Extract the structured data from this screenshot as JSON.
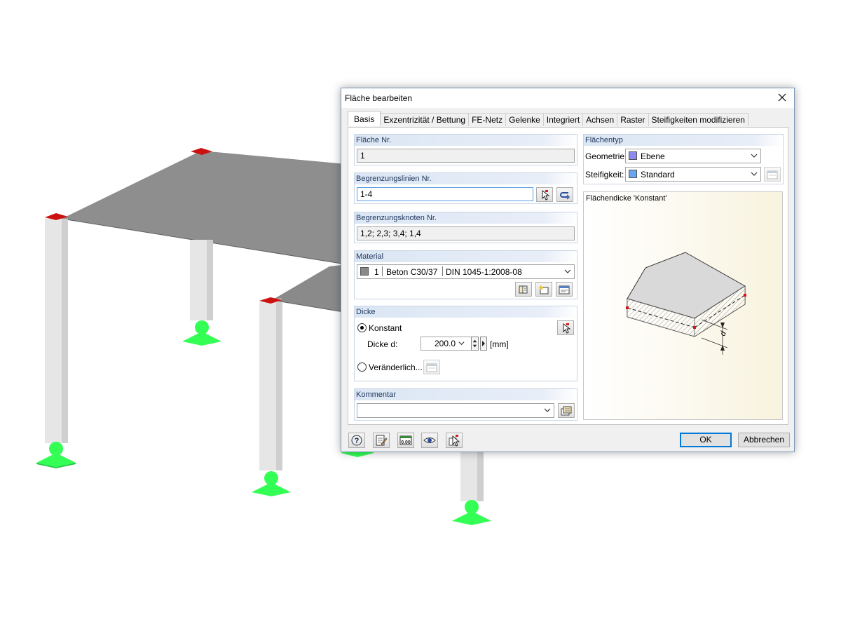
{
  "dialog": {
    "title": "Fläche bearbeiten",
    "tabs": [
      "Basis",
      "Exzentrizität / Bettung",
      "FE-Netz",
      "Gelenke",
      "Integriert",
      "Achsen",
      "Raster",
      "Steifigkeiten modifizieren"
    ],
    "active_tab": "Basis"
  },
  "surface_no": {
    "header": "Fläche Nr.",
    "value": "1"
  },
  "boundary_lines": {
    "header": "Begrenzungslinien Nr.",
    "value": "1-4"
  },
  "boundary_nodes": {
    "header": "Begrenzungsknoten Nr.",
    "value": "1,2; 2,3; 3,4; 1,4"
  },
  "material": {
    "header": "Material",
    "number": "1",
    "name": "Beton C30/37",
    "norm": "DIN 1045-1:2008-08",
    "color": "#8a8a8a"
  },
  "thickness": {
    "header": "Dicke",
    "constant_label": "Konstant",
    "thickness_label": "Dicke d:",
    "value": "200.0",
    "unit": "[mm]",
    "variable_label": "Veränderlich...",
    "selected": "Konstant"
  },
  "comment": {
    "header": "Kommentar",
    "value": ""
  },
  "surface_type": {
    "header": "Flächentyp",
    "geometry_label": "Geometrie:",
    "geometry_value": "Ebene",
    "geometry_color": "#8c8cf0",
    "stiffness_label": "Steifigkeit:",
    "stiffness_value": "Standard",
    "stiffness_color": "#6aa6f0"
  },
  "preview": {
    "caption": "Flächendicke 'Konstant'",
    "dimension_label": "d"
  },
  "buttons": {
    "ok": "OK",
    "cancel": "Abbrechen"
  },
  "colors": {
    "slab": "#8c8c8c",
    "column": "#e6e6e6",
    "support": "#33ff55",
    "node": "#cc1111",
    "dialog_border": "#7a98b8",
    "group_header": "#dbe6f4"
  }
}
